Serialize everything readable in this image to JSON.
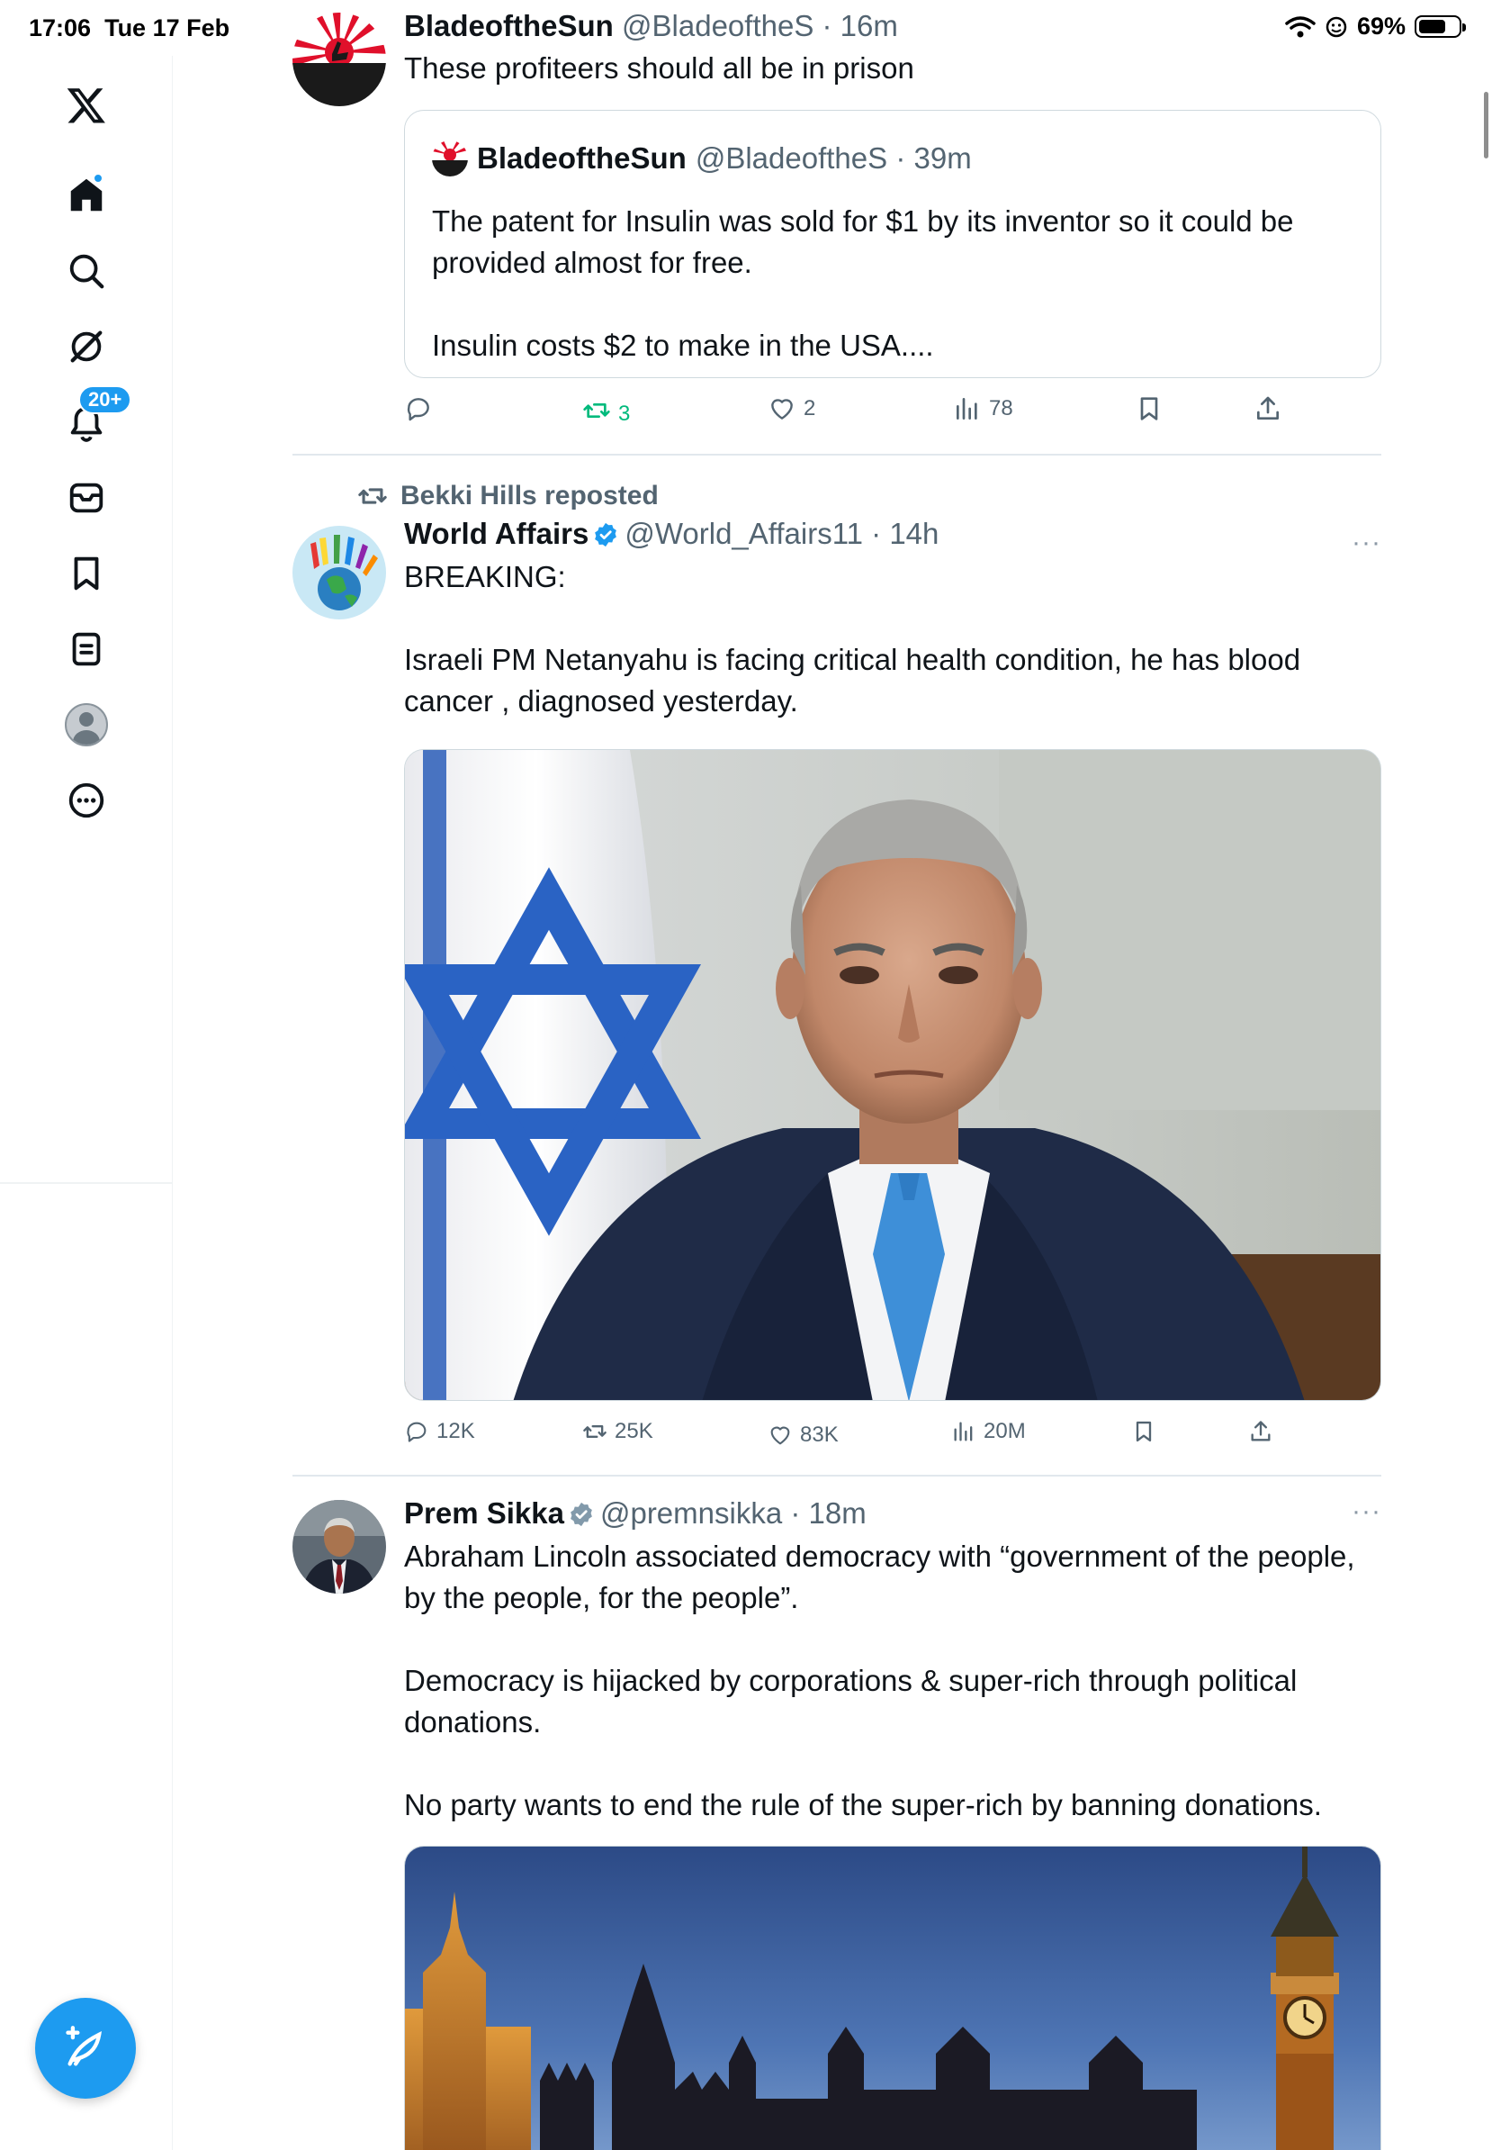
{
  "status_bar": {
    "time": "17:06",
    "date": "Tue 17 Feb",
    "battery": "69%",
    "battery_level": 0.69
  },
  "sidebar": {
    "items": [
      {
        "name": "x-logo-icon"
      },
      {
        "name": "home-icon",
        "has_dot": true
      },
      {
        "name": "search-icon"
      },
      {
        "name": "grok-icon"
      },
      {
        "name": "notifications-icon",
        "badge": "20+"
      },
      {
        "name": "messages-icon"
      },
      {
        "name": "bookmarks-icon"
      },
      {
        "name": "lists-icon"
      },
      {
        "name": "profile-icon"
      },
      {
        "name": "more-icon"
      }
    ],
    "accent_color": "#1d9bf0"
  },
  "tweets": [
    {
      "name": "BladeoftheSun",
      "handle": "@BladeoftheS",
      "time": "16m",
      "text": "These profiteers should all be in prison",
      "quote": {
        "name": "BladeoftheSun",
        "handle": "@BladeoftheS",
        "time": "39m",
        "text": "The patent for Insulin was sold for $1 by its inventor so it could be provided almost for free.\n\nInsulin costs $2 to make in the USA...."
      },
      "stats": {
        "replies": "",
        "reposts": "3",
        "likes": "2",
        "views": "78"
      },
      "repost_color": "#00ba7c"
    },
    {
      "reposted_by": "Bekki Hills reposted",
      "name": "World Affairs",
      "handle": "@World_Affairs11",
      "time": "14h",
      "text": "BREAKING:\n\nIsraeli PM Netanyahu is facing critical health condition, he has blood cancer , diagnosed yesterday.",
      "stats": {
        "replies": "12K",
        "reposts": "25K",
        "likes": "83K",
        "views": "20M"
      }
    },
    {
      "name": "Prem Sikka",
      "handle": "@premnsikka",
      "time": "18m",
      "text": "Abraham Lincoln associated democracy with “government of the people, by the people, for the people”.\n\nDemocracy is hijacked by corporations & super-rich through political donations.\n\nNo party wants to end the rule of the super-rich by banning donations."
    }
  ]
}
